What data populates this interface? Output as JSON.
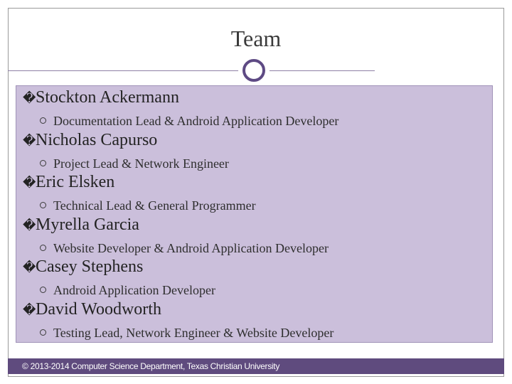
{
  "slide": {
    "title": "Team",
    "people": [
      {
        "bullet": "�",
        "name": "Stockton Ackermann",
        "role": "Documentation Lead & Android Application Developer"
      },
      {
        "bullet": "�",
        "name": "Nicholas Capurso",
        "role": "Project Lead & Network Engineer"
      },
      {
        "bullet": "�",
        "name": "Eric Elsken",
        "role": "Technical Lead & General Programmer"
      },
      {
        "bullet": "�",
        "name": "Myrella Garcia",
        "role": "Website Developer & Android Application Developer"
      },
      {
        "bullet": "�",
        "name": "Casey Stephens",
        "role": "Android Application Developer"
      },
      {
        "bullet": "�",
        "name": "David Woodworth",
        "role": "Testing Lead, Network Engineer & Website Developer"
      }
    ],
    "footer": "© 2013-2014 Computer Science Department, Texas Christian University"
  },
  "colors": {
    "accent": "#5e4a84",
    "content_background": "#cbbfdb",
    "footer_background": "#5f4b7e"
  }
}
